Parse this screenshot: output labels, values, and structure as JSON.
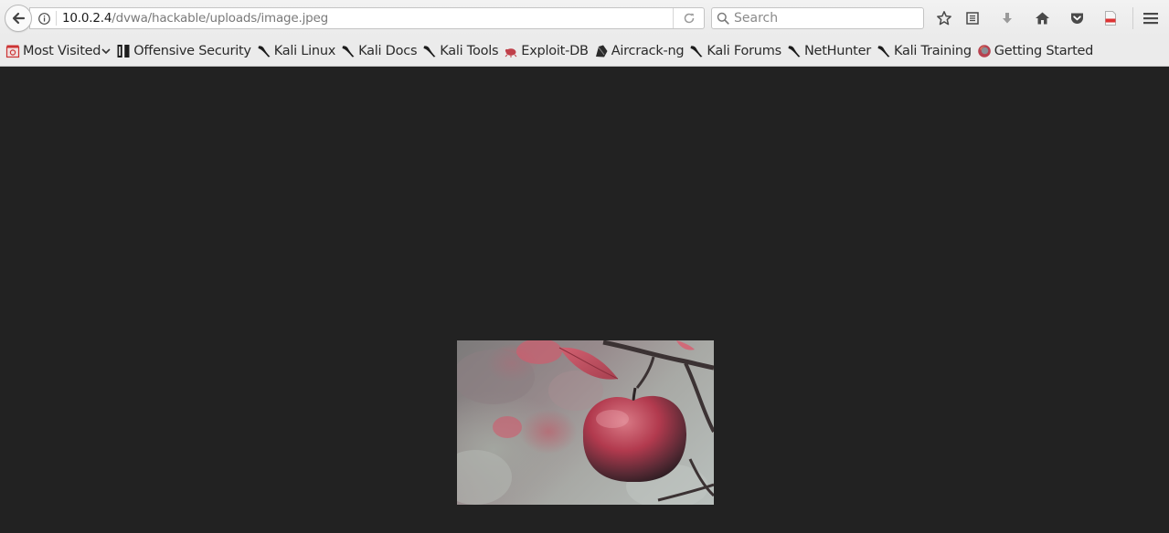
{
  "browser": {
    "url": {
      "host": "10.0.2.4",
      "path": "/dvwa/hackable/uploads/image.jpeg"
    },
    "search": {
      "placeholder": "Search"
    },
    "toolbar_icons": [
      "back-arrow-icon",
      "info-icon",
      "reload-icon",
      "search-icon",
      "star-icon",
      "reading-list-icon",
      "download-icon",
      "home-icon",
      "pocket-icon",
      "pdf-icon",
      "hamburger-menu-icon"
    ]
  },
  "bookmarks": [
    {
      "label": "Most Visited",
      "icon": "most-visited-icon",
      "dropdown": true
    },
    {
      "label": "Offensive Security",
      "icon": "offsec-icon"
    },
    {
      "label": "Kali Linux",
      "icon": "kali-dragon-icon"
    },
    {
      "label": "Kali Docs",
      "icon": "kali-dragon-icon"
    },
    {
      "label": "Kali Tools",
      "icon": "kali-dragon-icon"
    },
    {
      "label": "Exploit-DB",
      "icon": "exploitdb-icon"
    },
    {
      "label": "Aircrack-ng",
      "icon": "aircrack-icon"
    },
    {
      "label": "Kali Forums",
      "icon": "kali-dragon-icon"
    },
    {
      "label": "NetHunter",
      "icon": "kali-dragon-icon"
    },
    {
      "label": "Kali Training",
      "icon": "kali-dragon-icon"
    },
    {
      "label": "Getting Started",
      "icon": "firefox-icon"
    }
  ],
  "content": {
    "image": {
      "subject": "red apple hanging on a branch",
      "background_color": "#222222"
    }
  }
}
